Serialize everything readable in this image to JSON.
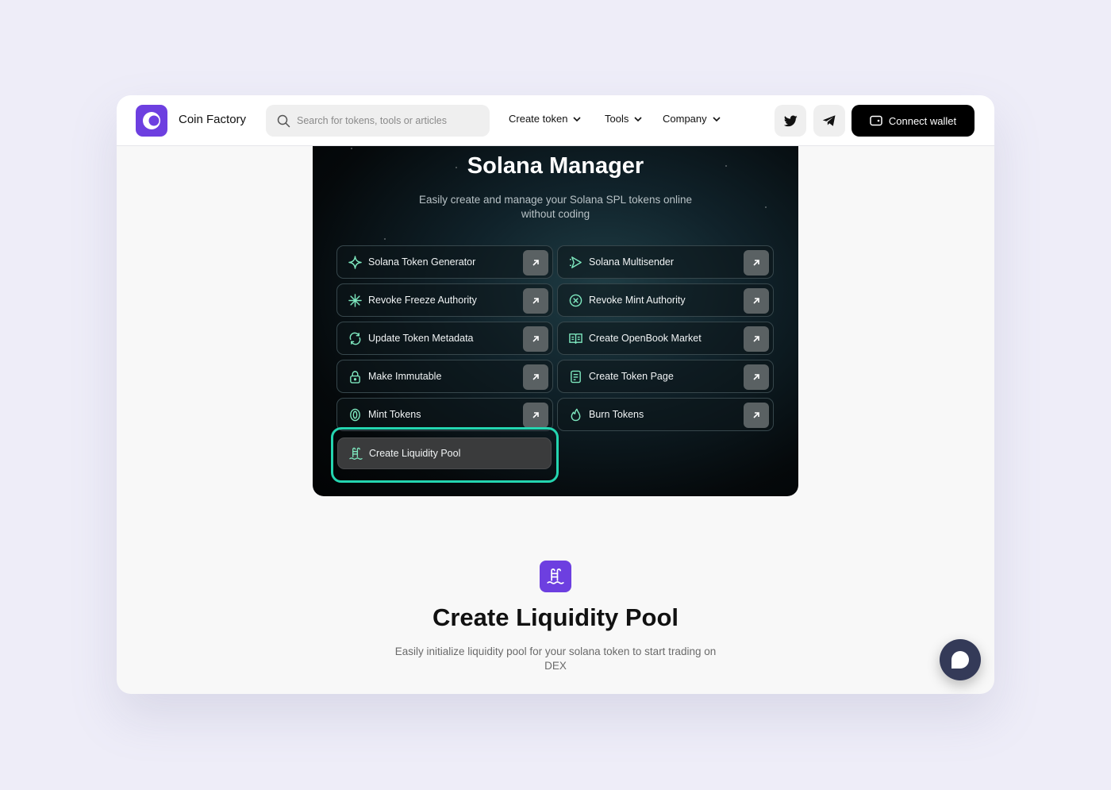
{
  "header": {
    "brand": "Coin Factory",
    "search_placeholder": "Search for tokens, tools or articles",
    "nav": [
      {
        "label": "Create token"
      },
      {
        "label": "Tools"
      },
      {
        "label": "Company"
      }
    ],
    "connect_label": "Connect wallet"
  },
  "manager": {
    "title": "Solana Manager",
    "subtitle": "Easily create and manage your Solana SPL tokens online without coding",
    "tools": [
      {
        "label": "Solana Token Generator",
        "icon": "sparkle-icon"
      },
      {
        "label": "Solana Multisender",
        "icon": "send-icon"
      },
      {
        "label": "Revoke Freeze Authority",
        "icon": "snowflake-icon"
      },
      {
        "label": "Revoke Mint Authority",
        "icon": "x-circle-icon"
      },
      {
        "label": "Update Token Metadata",
        "icon": "refresh-icon"
      },
      {
        "label": "Create OpenBook Market",
        "icon": "book-icon"
      },
      {
        "label": "Make Immutable",
        "icon": "lock-icon"
      },
      {
        "label": "Create Token Page",
        "icon": "page-icon"
      },
      {
        "label": "Mint Tokens",
        "icon": "coin-icon"
      },
      {
        "label": "Burn Tokens",
        "icon": "flame-icon"
      },
      {
        "label": "Create Liquidity Pool",
        "icon": "pool-icon"
      }
    ]
  },
  "feature": {
    "title": "Create Liquidity Pool",
    "description": "Easily initialize liquidity pool for your solana token to start trading on DEX"
  },
  "colors": {
    "brand_purple": "#6d3fe0",
    "highlight_teal": "#24d5b0",
    "icon_green": "#7ee8bf",
    "chat_navy": "#343a58"
  }
}
